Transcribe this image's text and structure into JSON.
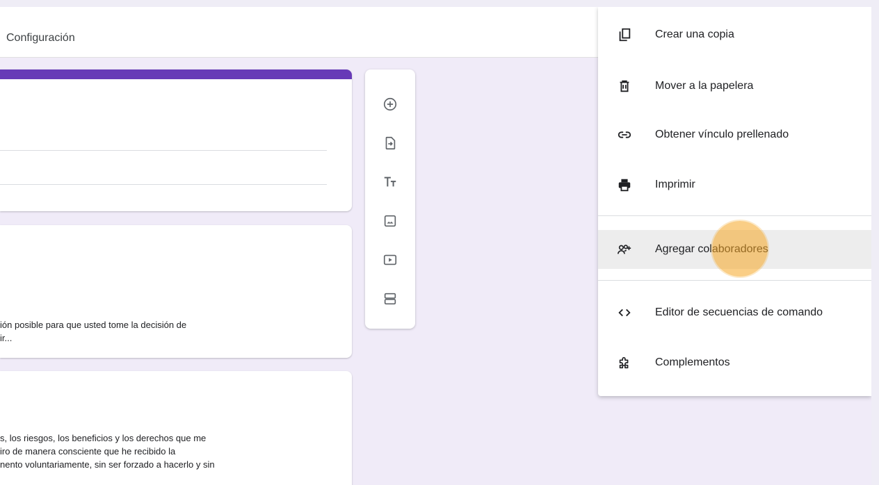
{
  "header": {
    "tab_label": "Configuración"
  },
  "cards": [
    {
      "id": "card-1"
    },
    {
      "id": "card-2",
      "text_lines": [
        "ión posible para que usted tome la decisión de",
        "ir..."
      ]
    },
    {
      "id": "card-3",
      "text_lines": [
        "s, los riesgos, los beneficios y los derechos que me",
        "iro de manera consciente que he recibido la",
        "nento voluntariamente, sin ser forzado a hacerlo y sin"
      ]
    }
  ],
  "toolbar": {
    "items": [
      {
        "name": "add-question-icon"
      },
      {
        "name": "import-questions-icon"
      },
      {
        "name": "add-title-icon"
      },
      {
        "name": "add-image-icon"
      },
      {
        "name": "add-video-icon"
      },
      {
        "name": "add-section-icon"
      }
    ]
  },
  "menu": {
    "items": [
      {
        "label": "Crear una copia",
        "icon": "copy-icon"
      },
      {
        "label": "Mover a la papelera",
        "icon": "trash-icon"
      },
      {
        "label": "Obtener vínculo prellenado",
        "icon": "link-icon"
      },
      {
        "label": "Imprimir",
        "icon": "print-icon"
      },
      {
        "label": "Agregar colaboradores",
        "icon": "add-people-icon",
        "hovered": true
      },
      {
        "label": "Editor de secuencias de comando",
        "icon": "code-icon"
      },
      {
        "label": "Complementos",
        "icon": "puzzle-icon"
      }
    ]
  },
  "colors": {
    "accent": "#673ab7",
    "background": "#f0ebf8",
    "hover": "#ededed",
    "cursor": "#f5a623"
  }
}
